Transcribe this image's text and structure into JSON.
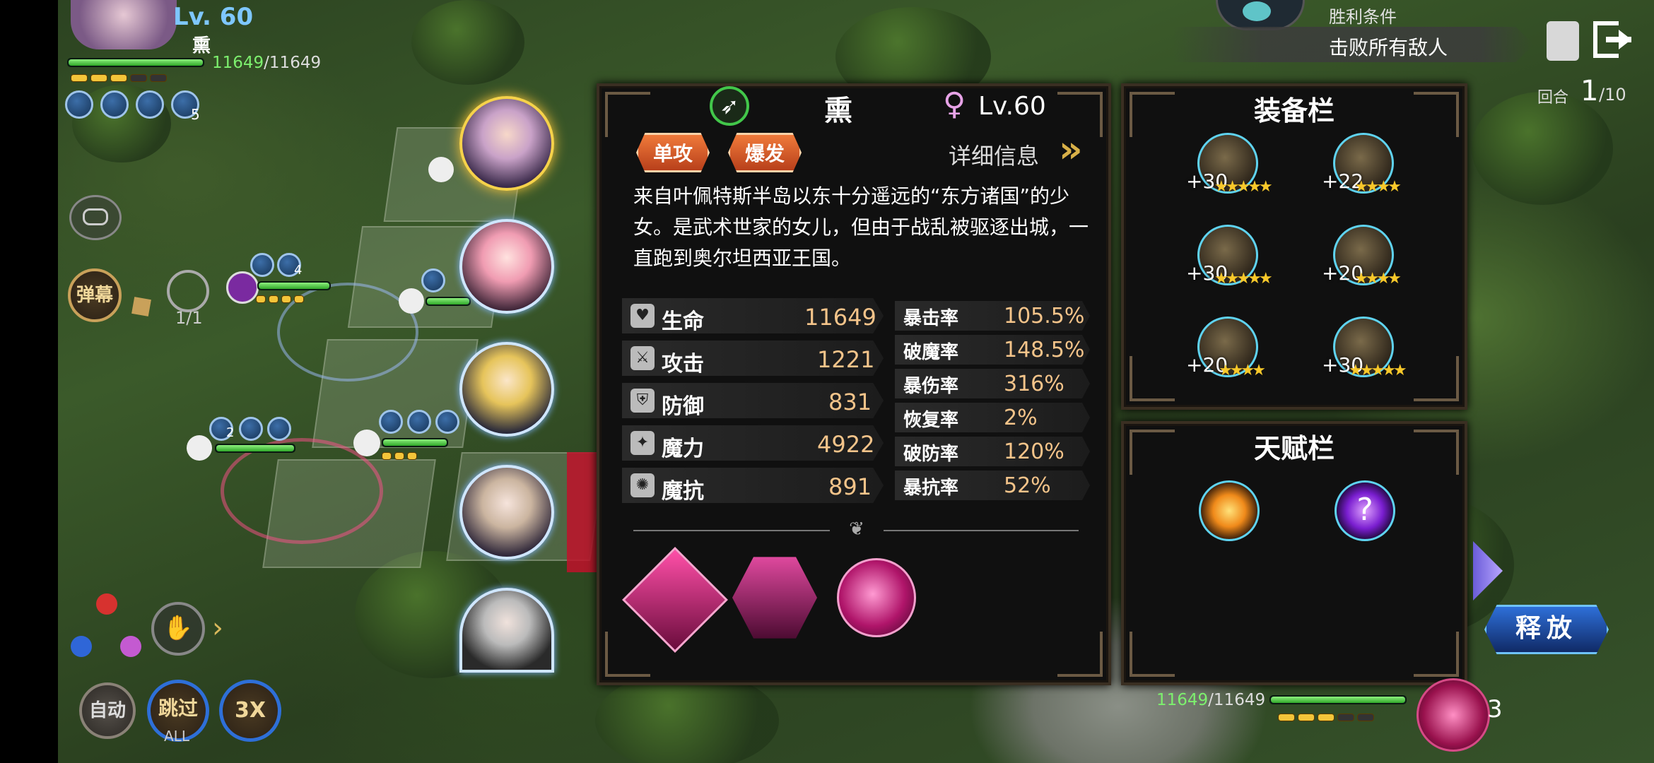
{
  "hero_header": {
    "level": "Lv. 60",
    "name": "熏",
    "hp_current": "11649",
    "hp_sep": "/",
    "hp_max": "11649"
  },
  "header_buff_count": "5",
  "win_condition": {
    "title": "胜利条件",
    "text": "击败所有敌人"
  },
  "round": {
    "label": "回合",
    "current": "1",
    "total": "/10"
  },
  "left_controls": {
    "danmaku": "弹幕",
    "timer_count": "1/1",
    "auto": "自动",
    "skip": "跳过",
    "skip_sub": "ALL",
    "speed": "3X"
  },
  "unit_badges": {
    "a": "4",
    "b": "2"
  },
  "character": {
    "name": "熏",
    "level": "Lv.60",
    "tags": [
      "单攻",
      "爆发"
    ],
    "detail_link": "详细信息",
    "description": "来自叶佩特斯半岛以东十分遥远的“东方诸国”的少女。是武术世家的女儿，但由于战乱被驱逐出城，一直跑到奥尔坦西亚王国。",
    "stats_left": [
      {
        "icon": "heart-icon",
        "label": "生命",
        "value": "11649"
      },
      {
        "icon": "sword-icon",
        "label": "攻击",
        "value": "1221"
      },
      {
        "icon": "shield-icon",
        "label": "防御",
        "value": "831"
      },
      {
        "icon": "magic-staff-icon",
        "label": "魔力",
        "value": "4922"
      },
      {
        "icon": "magic-resist-icon",
        "label": "魔抗",
        "value": "891"
      }
    ],
    "stats_right": [
      {
        "label": "暴击率",
        "value": "105.5%"
      },
      {
        "label": "破魔率",
        "value": "148.5%"
      },
      {
        "label": "暴伤率",
        "value": "316%"
      },
      {
        "label": "恢复率",
        "value": "2%"
      },
      {
        "label": "破防率",
        "value": "120%"
      },
      {
        "label": "暴抗率",
        "value": "52%"
      }
    ]
  },
  "equipment": {
    "title": "装备栏",
    "items": [
      {
        "plus": "+30",
        "stars": "★★★★★",
        "icon": "spellbook-icon"
      },
      {
        "plus": "+22",
        "stars": "★★★★",
        "icon": "gauntlet-icon"
      },
      {
        "plus": "+30",
        "stars": "★★★★★",
        "icon": "ring-icon"
      },
      {
        "plus": "+20",
        "stars": "★★★★",
        "icon": "pendant-icon"
      },
      {
        "plus": "+20",
        "stars": "★★★★",
        "icon": "bracelet-icon"
      },
      {
        "plus": "+30",
        "stars": "★★★★★",
        "icon": "scarf-icon"
      }
    ]
  },
  "talent": {
    "title": "天赋栏"
  },
  "bottom_bar": {
    "hp_current": "11649",
    "hp_sep": "/",
    "hp_max": "11649",
    "skill_count": "3",
    "release": "释放"
  },
  "colors": {
    "accent_orange": "#e4602a",
    "hp_green": "#3fd13a",
    "stat_value": "#f4c48a",
    "panel_bg": "#101010",
    "release_blue": "#1b4fa8"
  }
}
